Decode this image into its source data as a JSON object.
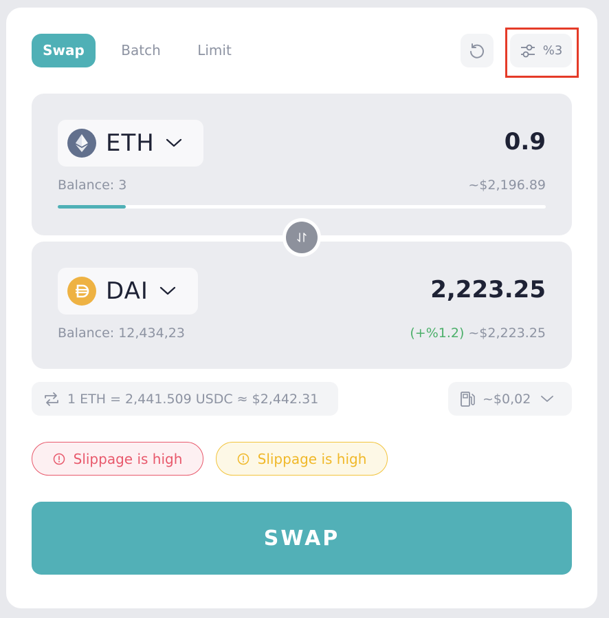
{
  "tabs": [
    {
      "label": "Swap",
      "active": true
    },
    {
      "label": "Batch",
      "active": false
    },
    {
      "label": "Limit",
      "active": false
    }
  ],
  "toolbar": {
    "refresh_icon": "refresh-icon",
    "slippage_icon": "sliders-icon",
    "slippage_value": "%3"
  },
  "from": {
    "token_symbol": "ETH",
    "token_icon": "eth-icon",
    "amount": "0.9",
    "balance": "Balance: 3",
    "usd_value": "~$2,196.89",
    "balance_used_fraction": 0.14
  },
  "to": {
    "token_symbol": "DAI",
    "token_icon": "dai-icon",
    "amount": "2,223.25",
    "balance": "Balance: 12,434,23",
    "price_impact": "(+%1.2)",
    "usd_value": "~$2,223.25"
  },
  "rate": {
    "text": "1 ETH = 2,441.509 USDC ≈ $2,442.31"
  },
  "gas": {
    "text": "~$0,02"
  },
  "warnings": [
    {
      "text": "Slippage is high",
      "level": "error"
    },
    {
      "text": "Slippage is high",
      "level": "warning"
    }
  ],
  "swap_button": {
    "label": "SWAP"
  },
  "colors": {
    "accent": "#4fb0b6",
    "positive": "#4caf6a",
    "error": "#e8596c",
    "warning": "#f0b829",
    "highlight": "#e53b28"
  }
}
